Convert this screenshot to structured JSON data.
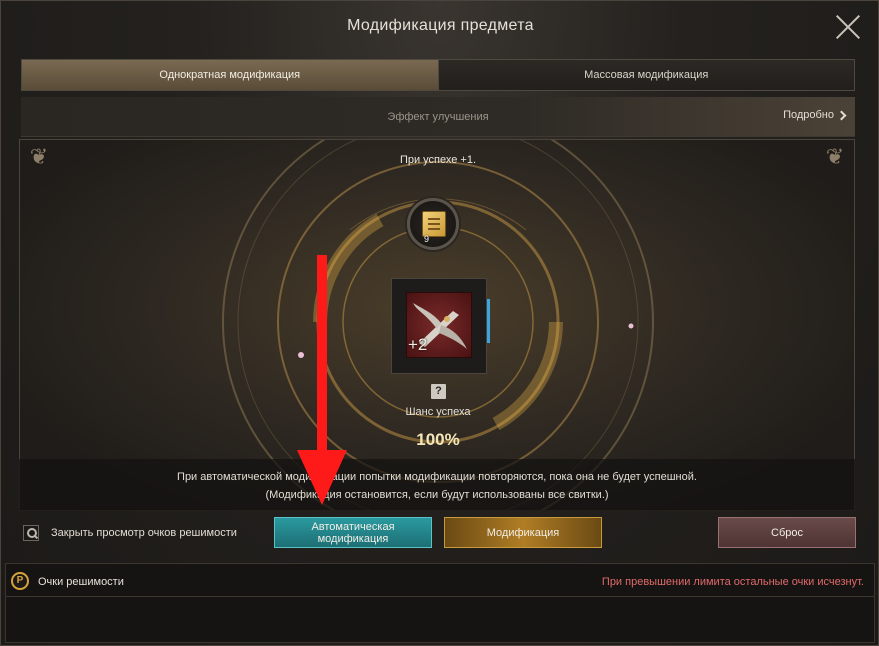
{
  "window": {
    "title": "Модификация предмета"
  },
  "tabs": [
    {
      "label": "Однократная модификация",
      "active": true
    },
    {
      "label": "Массовая модификация",
      "active": false
    }
  ],
  "effect_bar": {
    "label": "Эффект улучшения",
    "details_label": "Подробно"
  },
  "arena": {
    "success_text": "При успехе +1.",
    "scroll_count": "9",
    "item_level": "+2",
    "chance_label": "Шанс успеха",
    "chance_value": "100%"
  },
  "info": {
    "line1": "При автоматической модификации попытки модификации повторяются, пока она не будет успешной.",
    "line2": "(Модификация остановится, если будут использованы все свитки.)"
  },
  "controls": {
    "toggle_label": "Закрыть просмотр очков решимости",
    "auto_button": "Автоматическая модификация",
    "mod_button": "Модификация",
    "reset_button": "Сброс"
  },
  "bottom": {
    "points_icon": "P",
    "points_label": "Очки решимости",
    "limit_warning": "При превышении лимита остальные очки исчезнут."
  },
  "colors": {
    "auto_button": "#2a9aa0",
    "mod_button": "#b07d24",
    "reset_button": "#6a4a4a",
    "warning_text": "#e06a6a",
    "arrow": "#ff1a1a"
  }
}
